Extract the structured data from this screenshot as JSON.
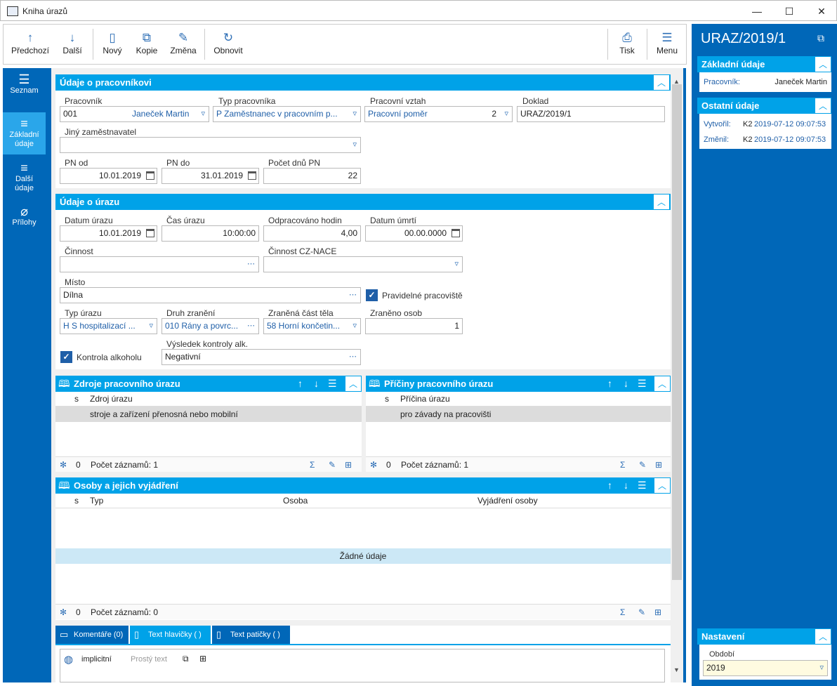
{
  "window": {
    "title": "Kniha úrazů",
    "minimize": "—",
    "maximize": "☐",
    "close": "✕"
  },
  "toolbar": {
    "prev": "Předchozí",
    "next": "Další",
    "new": "Nový",
    "copy": "Kopie",
    "change": "Změna",
    "refresh": "Obnovit",
    "print": "Tisk",
    "menu": "Menu"
  },
  "nav": {
    "list": "Seznam",
    "basic": "Základní údaje",
    "other": "Další údaje",
    "attachments": "Přílohy"
  },
  "worker": {
    "section_title": "Údaje o pracovníkovi",
    "worker_label": "Pracovník",
    "worker_code": "001",
    "worker_name": "Janeček Martin",
    "type_label": "Typ pracovníka",
    "type_value": "P Zaměstnanec v pracovním p...",
    "relation_label": "Pracovní vztah",
    "relation_value": "Pracovní poměr",
    "relation_num": "2",
    "doc_label": "Doklad",
    "doc_value": "URAZ/2019/1",
    "other_employer_label": "Jiný zaměstnavatel",
    "other_employer_value": "",
    "pn_from_label": "PN od",
    "pn_from": "10.01.2019",
    "pn_to_label": "PN do",
    "pn_to": "31.01.2019",
    "pn_days_label": "Počet dnů PN",
    "pn_days": "22"
  },
  "injury": {
    "section_title": "Údaje o úrazu",
    "date_label": "Datum úrazu",
    "date": "10.01.2019",
    "time_label": "Čas úrazu",
    "time": "10:00:00",
    "hours_label": "Odpracováno hodin",
    "hours": "4,00",
    "death_label": "Datum úmrtí",
    "death": "00.00.0000",
    "activity_label": "Činnost",
    "activity": "",
    "nace_label": "Činnost CZ-NACE",
    "nace": "",
    "place_label": "Místo",
    "place": "Dílna",
    "regular_label": "Pravidelné pracoviště",
    "kind_label": "Typ úrazu",
    "kind": "H S hospitalizací ...",
    "wound_label": "Druh zranění",
    "wound": "010 Rány a povrc...",
    "body_label": "Zraněná část těla",
    "body": "58 Horní končetin...",
    "persons_label": "Zraněno osob",
    "persons": "1",
    "alcohol_label": "Kontrola alkoholu",
    "alcohol_result_label": "Výsledek kontroly alk.",
    "alcohol_result": "Negativní"
  },
  "sources": {
    "title": "Zdroje pracovního úrazu",
    "col_s": "s",
    "col_name": "Zdroj úrazu",
    "rows": [
      "stroje a zařízení přenosná nebo mobilní"
    ],
    "count_zero": "0",
    "count_text": "Počet záznamů: 1"
  },
  "causes": {
    "title": "Příčiny pracovního úrazu",
    "col_s": "s",
    "col_name": "Příčina úrazu",
    "rows": [
      "pro závady na pracovišti"
    ],
    "count_zero": "0",
    "count_text": "Počet záznamů: 1"
  },
  "persons": {
    "title": "Osoby a jejich vyjádření",
    "col_s": "s",
    "col_type": "Typ",
    "col_person": "Osoba",
    "col_statement": "Vyjádření osoby",
    "empty": "Žádné údaje",
    "count_zero": "0",
    "count_text": "Počet záznamů: 0"
  },
  "bottom_tabs": {
    "comments": "Komentáře (0)",
    "header_text": "Text hlavičky ( )",
    "footer_text": "Text patičky ( )"
  },
  "editor": {
    "lang": "implicitní",
    "format": "Prostý text"
  },
  "right": {
    "doc_id": "URAZ/2019/1",
    "basic_title": "Základní údaje",
    "worker_label": "Pracovník:",
    "worker_value": "Janeček Martin",
    "other_title": "Ostatní údaje",
    "created_label": "Vytvořil:",
    "created_user": "K2",
    "created_date": "2019-07-12 09:07:53",
    "changed_label": "Změnil:",
    "changed_user": "K2",
    "changed_date": "2019-07-12 09:07:53",
    "settings_title": "Nastavení",
    "period_label": "Období",
    "period_value": "2019"
  }
}
